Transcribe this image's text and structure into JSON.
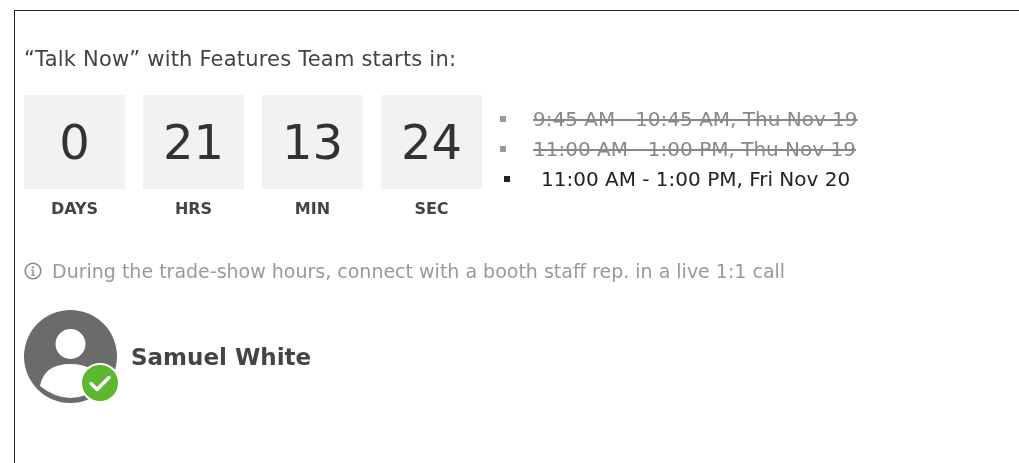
{
  "heading": "“Talk Now” with Features Team starts in:",
  "countdown": [
    {
      "value": "0",
      "unit": "DAYS"
    },
    {
      "value": "21",
      "unit": "HRS"
    },
    {
      "value": "13",
      "unit": "MIN"
    },
    {
      "value": "24",
      "unit": "SEC"
    }
  ],
  "slots": [
    {
      "text": "9:45 AM - 10:45 AM, Thu Nov 19",
      "past": true
    },
    {
      "text": "11:00 AM - 1:00 PM, Thu Nov 19",
      "past": true
    },
    {
      "text": "11:00 AM - 1:00 PM, Fri Nov 20",
      "past": false
    }
  ],
  "info": "During the trade-show hours, connect with a booth staff rep. in a live 1:1 call",
  "contact": {
    "name": "Samuel White",
    "online": true
  }
}
